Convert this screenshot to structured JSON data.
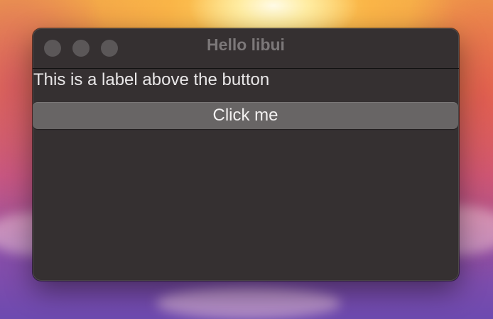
{
  "window": {
    "title": "Hello libui",
    "controls": [
      "close-icon",
      "minimize-icon",
      "zoom-icon"
    ]
  },
  "content": {
    "label_text": "This is a label above the button",
    "button_label": "Click me"
  },
  "colors": {
    "window_bg": "#353031",
    "button_bg": "#686565",
    "traffic_light": "#5b5758",
    "title_text": "#7c7879",
    "label_text": "#e9e7e8"
  }
}
